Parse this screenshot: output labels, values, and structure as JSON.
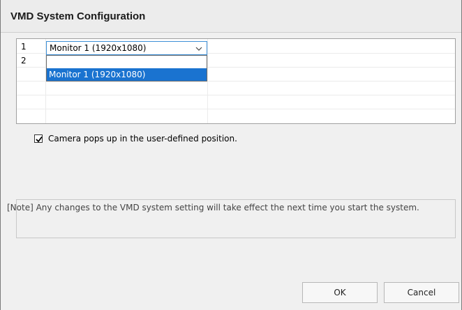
{
  "window": {
    "title": "VMD System Configuration"
  },
  "grid": {
    "rows": [
      {
        "num": "1",
        "monitor": "Monitor 1  (1920x1080)"
      },
      {
        "num": "2",
        "monitor": ""
      }
    ],
    "dropdown": {
      "options": [
        "",
        "Monitor 1  (1920x1080)"
      ],
      "highlighted": "Monitor 1  (1920x1080)"
    }
  },
  "options": {
    "camera_popup_label": "Camera pops up in the user-defined position.",
    "camera_popup_checked": true
  },
  "note": {
    "text": "[Note] Any changes to the VMD system setting will take effect the next time you start the system."
  },
  "buttons": {
    "ok_label": "OK",
    "cancel_label": "Cancel"
  },
  "colors": {
    "selection_blue": "#1a73d0",
    "focus_border": "#3c8fd6",
    "dialog_bg": "#f0f0f0"
  },
  "icons": {
    "combo_arrow": "chevron-down-icon",
    "checkbox_mark": "checkmark-icon"
  }
}
